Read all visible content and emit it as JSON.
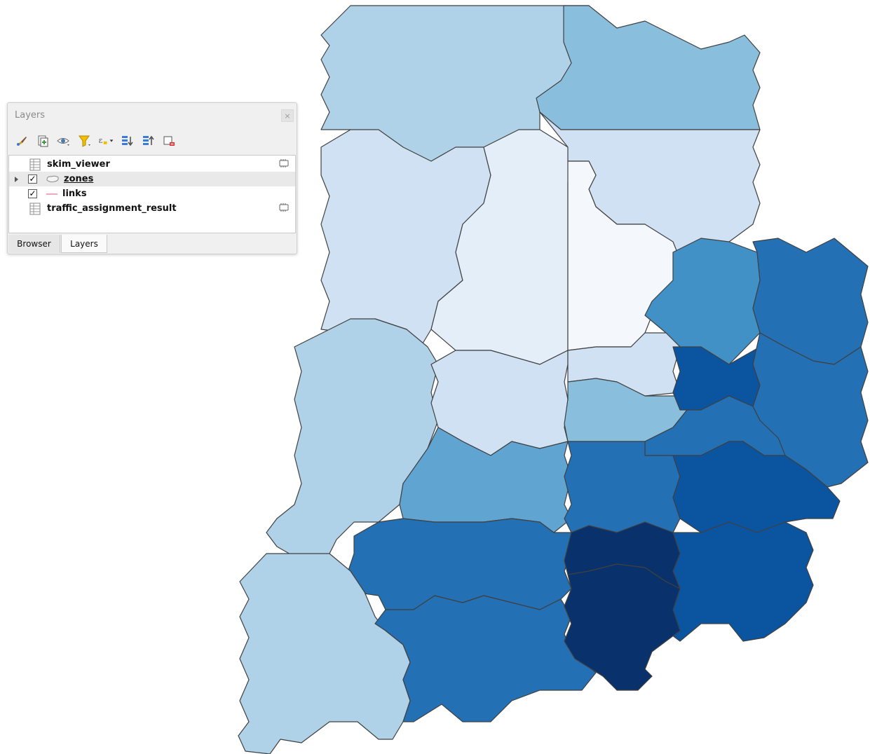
{
  "panel": {
    "title": "Layers",
    "close_glyph": "×",
    "toolbar_icons": [
      "style-brush-icon",
      "add-group-icon",
      "visibility-eye-icon",
      "filter-icon",
      "expression-filter-icon",
      "expand-all-icon",
      "collapse-all-icon",
      "remove-layer-icon"
    ],
    "layers": [
      {
        "name": "skim_viewer",
        "type": "table",
        "checked": null,
        "selected": false
      },
      {
        "name": "zones",
        "type": "polygon",
        "checked": true,
        "selected": true
      },
      {
        "name": "links",
        "type": "line",
        "checked": true,
        "selected": false
      },
      {
        "name": "traffic_assignment_result",
        "type": "table",
        "checked": null,
        "selected": false
      }
    ],
    "check_glyph": "✓",
    "tabs": [
      {
        "label": "Browser",
        "active": false
      },
      {
        "label": "Layers",
        "active": true
      }
    ]
  },
  "map": {
    "colors": {
      "c1": "#f7fbff",
      "c2": "#deebf7",
      "c3": "#c6dbef",
      "c4": "#9ecae1",
      "c5": "#6baed6",
      "c6": "#4292c6",
      "c7": "#2171b5",
      "c8": "#08519c",
      "c9": "#08306b"
    },
    "link_color": "#f4a6c0"
  }
}
